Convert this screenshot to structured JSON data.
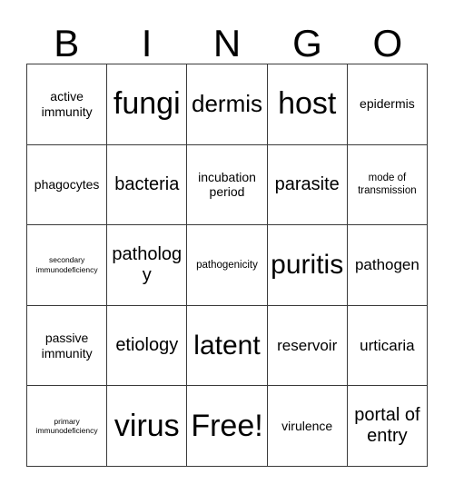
{
  "card": {
    "header_letters": [
      "B",
      "I",
      "N",
      "G",
      "O"
    ],
    "cells": [
      {
        "text": "active immunity",
        "size": "md"
      },
      {
        "text": "fungi",
        "size": "4xl"
      },
      {
        "text": "dermis",
        "size": "2xl"
      },
      {
        "text": "host",
        "size": "4xl"
      },
      {
        "text": "epidermis",
        "size": "md"
      },
      {
        "text": "phagocytes",
        "size": "md"
      },
      {
        "text": "bacteria",
        "size": "xl"
      },
      {
        "text": "incubation period",
        "size": "md"
      },
      {
        "text": "parasite",
        "size": "xl"
      },
      {
        "text": "mode of transmission",
        "size": "sm"
      },
      {
        "text": "secondary immunodeficiency",
        "size": "xs"
      },
      {
        "text": "pathology",
        "size": "xl"
      },
      {
        "text": "pathogenicity",
        "size": "sm"
      },
      {
        "text": "puritis",
        "size": "3xl"
      },
      {
        "text": "pathogen",
        "size": "lg"
      },
      {
        "text": "passive immunity",
        "size": "md"
      },
      {
        "text": "etiology",
        "size": "xl"
      },
      {
        "text": "latent",
        "size": "3xl"
      },
      {
        "text": "reservoir",
        "size": "lg"
      },
      {
        "text": "urticaria",
        "size": "lg"
      },
      {
        "text": "primary immunodeficiency",
        "size": "xs"
      },
      {
        "text": "virus",
        "size": "4xl"
      },
      {
        "text": "Free!",
        "size": "4xl"
      },
      {
        "text": "virulence",
        "size": "md"
      },
      {
        "text": "portal of entry",
        "size": "xl"
      }
    ],
    "colors": {
      "text": "#000000",
      "border": "#3a3a3a",
      "background": "#ffffff"
    }
  }
}
